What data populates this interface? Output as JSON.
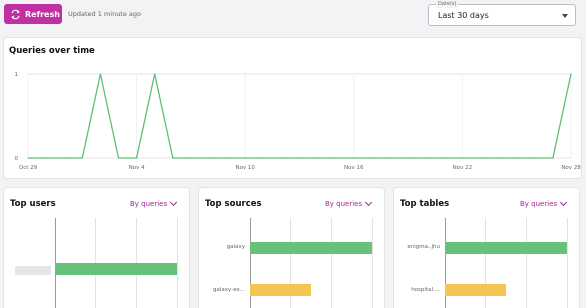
{
  "toolbar": {
    "refresh_label": "Refresh",
    "updated_text": "Updated 1 minute ago",
    "accent_color": "#c12fa5"
  },
  "date_filter": {
    "legend": "Date(s)",
    "value": "Last 30 days"
  },
  "queries_over_time": {
    "title": "Queries over time"
  },
  "chart_data": {
    "type": "line",
    "title": "Queries over time",
    "xlabel": "",
    "ylabel": "",
    "x_ticks": [
      "Oct 29",
      "Nov 4",
      "Nov 10",
      "Nov 16",
      "Nov 22",
      "Nov 28"
    ],
    "y_ticks": [
      0,
      1
    ],
    "ylim": [
      0,
      1
    ],
    "xlim": [
      "Oct 29",
      "Nov 28"
    ],
    "grid": true,
    "color": "#5fbf72",
    "series": [
      {
        "x": [
          "Oct 29",
          "Oct 30",
          "Oct 31",
          "Nov 1",
          "Nov 2",
          "Nov 3",
          "Nov 4",
          "Nov 5",
          "Nov 6",
          "Nov 7",
          "Nov 8",
          "Nov 9",
          "Nov 10",
          "Nov 11",
          "Nov 12",
          "Nov 13",
          "Nov 14",
          "Nov 15",
          "Nov 16",
          "Nov 17",
          "Nov 18",
          "Nov 19",
          "Nov 20",
          "Nov 21",
          "Nov 22",
          "Nov 23",
          "Nov 24",
          "Nov 25",
          "Nov 26",
          "Nov 27",
          "Nov 28"
        ],
        "values": [
          0,
          0,
          0,
          0,
          1,
          0,
          0,
          1,
          0,
          0,
          0,
          0,
          0,
          0,
          0,
          0,
          0,
          0,
          0,
          0,
          0,
          0,
          0,
          0,
          0,
          0,
          0,
          0,
          0,
          0,
          1
        ]
      }
    ]
  },
  "top_users": {
    "title": "Top users",
    "sort_label": "By queries",
    "items": [
      {
        "label": "",
        "value": 1,
        "color": "#67c17a"
      }
    ]
  },
  "top_sources": {
    "title": "Top sources",
    "sort_label": "By queries",
    "items": [
      {
        "label": "galaxy",
        "value": 1,
        "color": "#67c17a"
      },
      {
        "label": "galaxy-ex...",
        "value": 0.5,
        "color": "#f3c654"
      }
    ]
  },
  "top_tables": {
    "title": "Top tables",
    "sort_label": "By queries",
    "items": [
      {
        "label": "enigma..jhu",
        "value": 1,
        "color": "#67c17a"
      },
      {
        "label": "hospital....",
        "value": 0.5,
        "color": "#f3c654"
      }
    ]
  }
}
